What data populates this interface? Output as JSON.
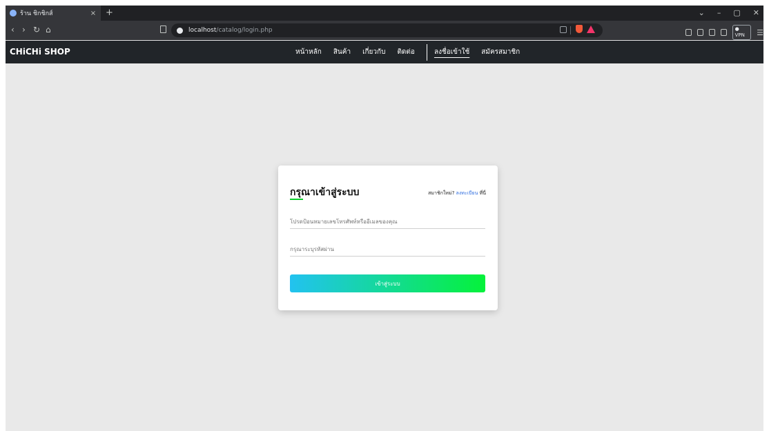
{
  "browser": {
    "tab_title": "ร้าน ชิกชิกส์",
    "tab_close": "×",
    "new_tab": "+",
    "url_host": "localhost",
    "url_path": "/catalog/login.php",
    "vpn_label": "● VPN",
    "window_controls": [
      "⌄",
      "–",
      "▢",
      "✕"
    ],
    "nav_buttons": [
      "‹",
      "›",
      "↻",
      "⌂"
    ]
  },
  "site": {
    "brand": "CHiCHi SHOP",
    "nav": [
      {
        "label": "หน้าหลัก"
      },
      {
        "label": "สินค้า"
      },
      {
        "label": "เกี่ยวกับ"
      },
      {
        "label": "ติดต่อ"
      },
      {
        "label": "ลงชื่อเข้าใช้",
        "active": true
      },
      {
        "label": "สมัครสมาชิก"
      }
    ]
  },
  "login": {
    "title": "กรุณาเข้าสู่ระบบ",
    "register_prefix": "สมาชิกใหม่?",
    "register_link": "ลงทะเบียน",
    "register_suffix": "ที่นี่",
    "phone_placeholder": "โปรดป้อนหมายเลขโทรศัพท์หรืออีเมลของคุณ",
    "password_placeholder": "กรุณาระบุรหัสผ่าน",
    "submit": "เข้าสู่ระบบ"
  },
  "colors": {
    "accent_green": "#05f23a",
    "accent_cyan": "#22c2f0",
    "nav_bg": "#212529",
    "page_bg": "#e9e9e9"
  }
}
